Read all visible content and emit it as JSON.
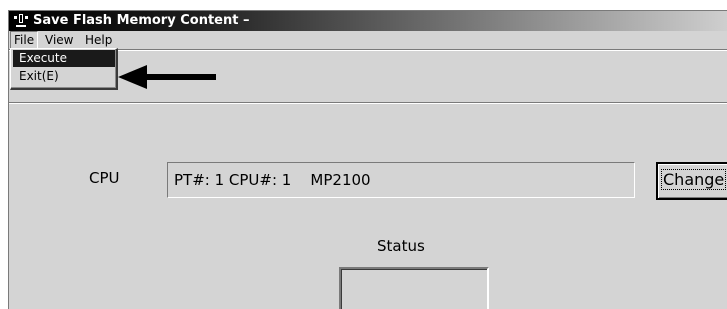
{
  "window": {
    "title": "Save Flash Memory Content –"
  },
  "menubar": {
    "file": "File",
    "view": "View",
    "help": "Help"
  },
  "file_menu": {
    "items": [
      {
        "label": "Execute",
        "selected": true
      },
      {
        "label": "Exit(E)",
        "selected": false
      }
    ]
  },
  "cpu": {
    "label": "CPU",
    "value": "PT#: 1 CPU#: 1    MP2100",
    "change_button": "Change"
  },
  "status": {
    "label": "Status",
    "value": ""
  },
  "colors": {
    "selection": "#1a1a1a",
    "face": "#d4d4d4"
  }
}
